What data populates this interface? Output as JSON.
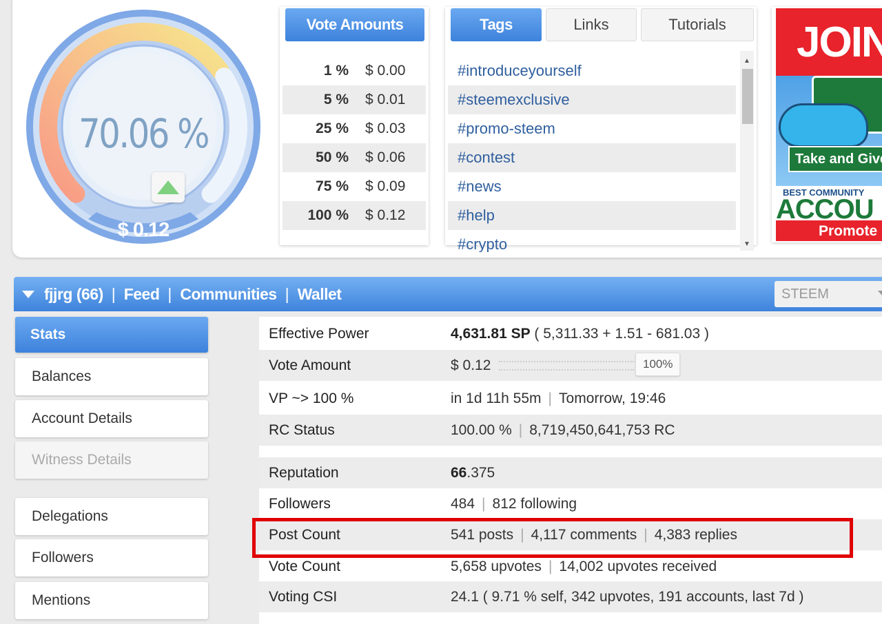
{
  "gauge": {
    "percent_text": "70.06 %",
    "percent_value": 70.06,
    "value_text": "$ 0.12",
    "colors": {
      "ring": "#7da6e3",
      "arc_start": "#f7a083",
      "arc_end": "#f5e18a",
      "text": "#7fa2c4"
    }
  },
  "vote_amounts": {
    "tab_label": "Vote Amounts",
    "rows": [
      {
        "pct": "1 %",
        "usd": "$ 0.00"
      },
      {
        "pct": "5 %",
        "usd": "$ 0.01"
      },
      {
        "pct": "25 %",
        "usd": "$ 0.03"
      },
      {
        "pct": "50 %",
        "usd": "$ 0.06"
      },
      {
        "pct": "75 %",
        "usd": "$ 0.09"
      },
      {
        "pct": "100 %",
        "usd": "$ 0.12"
      }
    ]
  },
  "tags_panel": {
    "tabs": [
      "Tags",
      "Links",
      "Tutorials"
    ],
    "active_tab": "Tags",
    "items": [
      "#introduceyourself",
      "#steemexclusive",
      "#promo-steem",
      "#contest",
      "#news",
      "#help",
      "#crypto"
    ]
  },
  "ad": {
    "join": "JOIN",
    "take": "Take and Give",
    "best_small": "BEST COMMUNITY",
    "best_big": "ACCOU",
    "promote": "Promote"
  },
  "account_bar": {
    "links": [
      "fjjrg (66)",
      "Feed",
      "Communities",
      "Wallet"
    ],
    "currency": "STEEM"
  },
  "sidebar": {
    "items": [
      "Stats",
      "Balances",
      "Account Details",
      "Witness Details",
      "Delegations",
      "Followers",
      "Mentions"
    ],
    "active": "Stats",
    "disabled": "Witness Details"
  },
  "stats": {
    "effective_power": {
      "label": "Effective Power",
      "main": "4,631.81 SP",
      "detail": " ( 5,311.33 + 1.51 - 681.03 )"
    },
    "vote_amount": {
      "label": "Vote Amount",
      "value": "$ 0.12",
      "slider": "100%"
    },
    "vp": {
      "label": "VP ~> 100 %",
      "a": "in 1d 11h 55m",
      "b": "Tomorrow, 19:46"
    },
    "rc_status": {
      "label": "RC Status",
      "a": "100.00 %",
      "b": "8,719,450,641,753 RC"
    },
    "reputation": {
      "label": "Reputation",
      "int": "66",
      "dec": ".375"
    },
    "followers": {
      "label": "Followers",
      "a": "484",
      "b": "812 following"
    },
    "post_count": {
      "label": "Post Count",
      "a": "541 posts",
      "b": "4,117 comments",
      "c": "4,383 replies"
    },
    "vote_count": {
      "label": "Vote Count",
      "a": "5,658 upvotes",
      "b": "14,002 upvotes received"
    },
    "voting_csi": {
      "label": "Voting CSI",
      "value": "24.1 ( 9.71 % self, 342 upvotes, 191 accounts, last 7d )"
    }
  },
  "accent": {
    "blue": "#4a8fe4",
    "highlight": "#e00000"
  }
}
